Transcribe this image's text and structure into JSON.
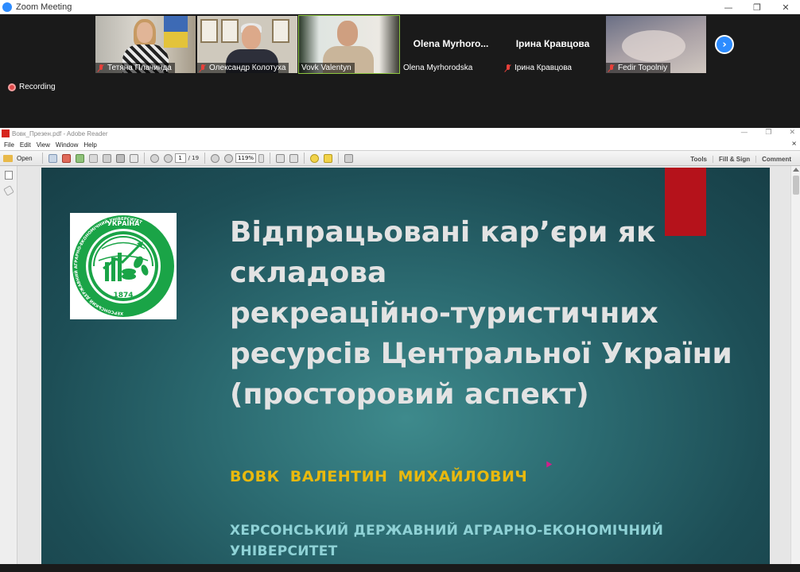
{
  "zoom": {
    "window_title": "Zoom Meeting",
    "controls": {
      "minimize": "—",
      "restore": "❐",
      "close": "✕"
    },
    "participants": [
      {
        "name": "Тетяна Плачинда"
      },
      {
        "name": "Олександр Колотуха"
      },
      {
        "name": "Vovk Valentyn"
      },
      {
        "name": "Olena  Myrhorodska",
        "display_name": "Olena   Myrhoro..."
      },
      {
        "name": "Ірина Кравцова",
        "display_name": "Ірина Кравцова"
      },
      {
        "name": "Fedir Topolniy"
      }
    ],
    "next_page": "›",
    "recording_label": "Recording",
    "accent_color": "#2d8cff",
    "active_speaker_border": "#8dc63f"
  },
  "reader": {
    "window_title": "Вовк_Презен.pdf - Adobe Reader",
    "window_controls": {
      "minimize": "—",
      "restore": "❐",
      "close": "✕"
    },
    "menu": [
      "File",
      "Edit",
      "View",
      "Window",
      "Help"
    ],
    "menu_close": "×",
    "toolbar": {
      "open_label": "Open",
      "page_current": "1",
      "page_total": "/ 19",
      "zoom": "119%",
      "tools_label": "Tools",
      "fill_sign_label": "Fill & Sign",
      "comment_label": "Comment"
    }
  },
  "slide": {
    "title_lines": [
      "Відпрацьовані кар’єри як",
      "складова",
      "рекреаційно-туристичних",
      "ресурсів Центральної України",
      "(просторовий аспект)"
    ],
    "author": "ВОВК  ВАЛЕНТИН  МИХАЙЛОВИЧ",
    "org_lines": [
      "ХЕРСОНСЬКИЙ ДЕРЖАВНИЙ АГРАРНО-ЕКОНОМІЧНИЙ",
      "УНІВЕРСИТЕТ"
    ],
    "logo": {
      "top_text": "УКРАЇНА",
      "ring_text": "ХЕРСОНСЬКИЙ ДЕРЖАВНИЙ АГРАРНО-ЕКОНОМІЧНИЙ УНІВЕРСИТЕТ",
      "year": "1874",
      "color": "#1aa447"
    },
    "colors": {
      "title": "#e3e3e3",
      "author": "#e9b90e",
      "org": "#8fd2d6",
      "accent_red": "#b5121b"
    }
  }
}
